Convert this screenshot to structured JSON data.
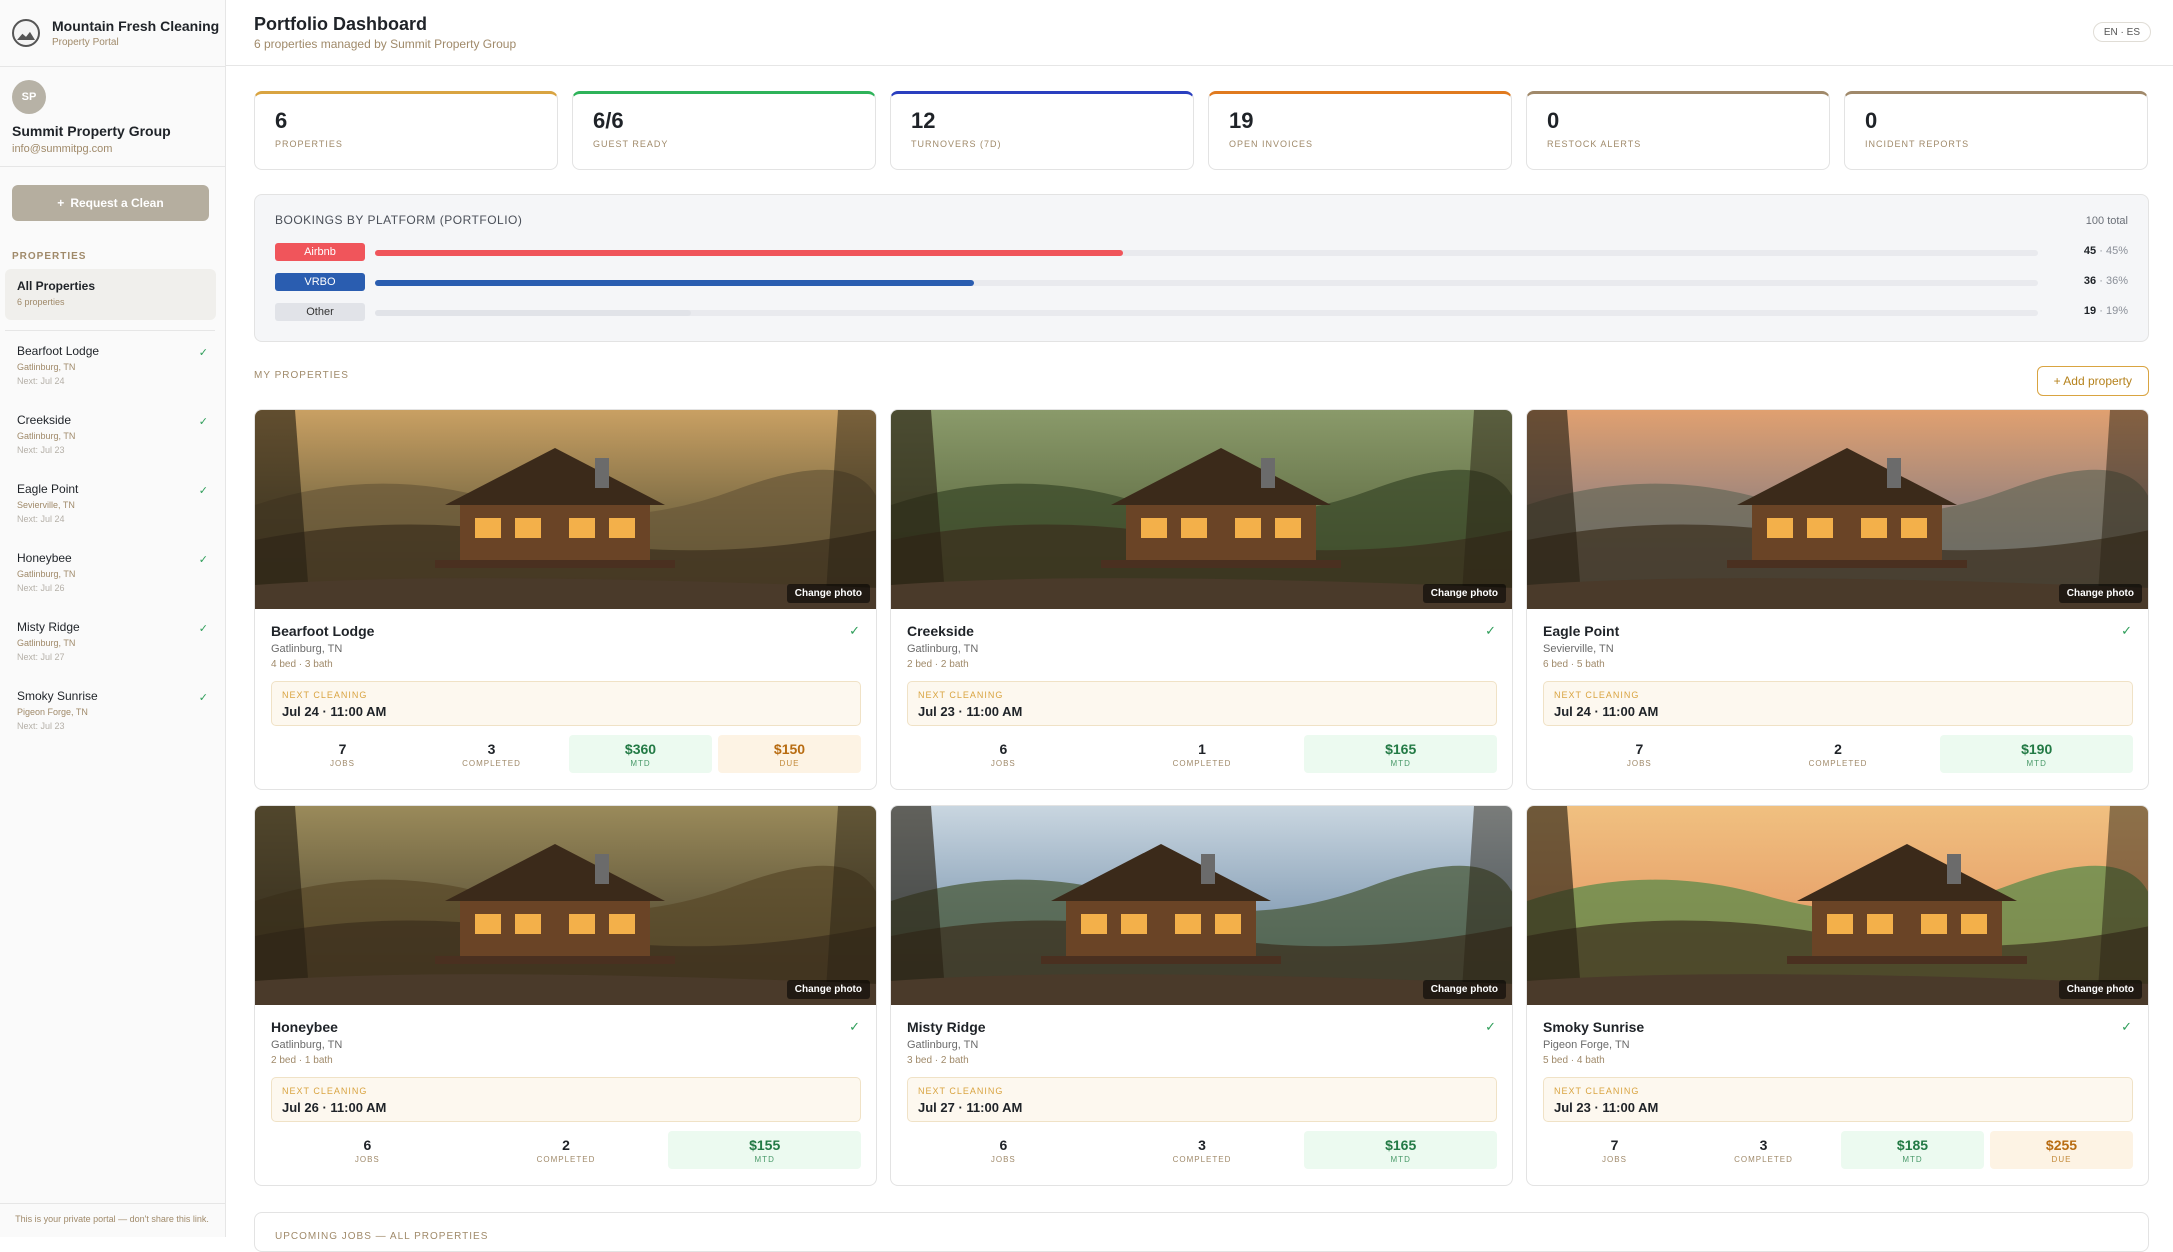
{
  "brand": {
    "name": "Mountain Fresh Cleaning",
    "subtitle": "Property Portal"
  },
  "client": {
    "initials": "SP",
    "name": "Summit Property Group",
    "email": "info@summitpg.com"
  },
  "sidebar": {
    "request_label": "Request a Clean",
    "request_icon": "+",
    "section_label": "PROPERTIES",
    "all_properties": {
      "label": "All Properties",
      "count": "6 properties"
    },
    "properties": [
      {
        "name": "Bearfoot Lodge",
        "location": "Gatlinburg, TN",
        "next": "Next: Jul 24"
      },
      {
        "name": "Creekside",
        "location": "Gatlinburg, TN",
        "next": "Next: Jul 23"
      },
      {
        "name": "Eagle Point",
        "location": "Sevierville, TN",
        "next": "Next: Jul 24"
      },
      {
        "name": "Honeybee",
        "location": "Gatlinburg, TN",
        "next": "Next: Jul 26"
      },
      {
        "name": "Misty Ridge",
        "location": "Gatlinburg, TN",
        "next": "Next: Jul 27"
      },
      {
        "name": "Smoky Sunrise",
        "location": "Pigeon Forge, TN",
        "next": "Next: Jul 23"
      }
    ],
    "footer": "This is your private portal — don't share this link."
  },
  "header": {
    "title": "Portfolio Dashboard",
    "subtitle": "6 properties managed by Summit Property Group",
    "lang": "EN · ES"
  },
  "stats": [
    {
      "value": "6",
      "label": "PROPERTIES",
      "color": "#d9a441"
    },
    {
      "value": "6/6",
      "label": "GUEST READY",
      "color": "#2fb35a"
    },
    {
      "value": "12",
      "label": "TURNOVERS (7D)",
      "color": "#2a3fbf"
    },
    {
      "value": "19",
      "label": "OPEN INVOICES",
      "color": "#e07a1f"
    },
    {
      "value": "0",
      "label": "RESTOCK ALERTS",
      "color": "#a0896a"
    },
    {
      "value": "0",
      "label": "INCIDENT REPORTS",
      "color": "#a0896a"
    }
  ],
  "bookings": {
    "title": "BOOKINGS BY PLATFORM (PORTFOLIO)",
    "total": "100 total",
    "platforms": [
      {
        "name": "Airbnb",
        "count": "45",
        "pct": "45%",
        "share": 0.45,
        "color": "#f0555b",
        "text": "#ffffff"
      },
      {
        "name": "VRBO",
        "count": "36",
        "pct": "36%",
        "share": 0.36,
        "color": "#2a5db0",
        "text": "#ffffff"
      },
      {
        "name": "Other",
        "count": "19",
        "pct": "19%",
        "share": 0.19,
        "color": "#e1e3e8",
        "text": "#333333"
      }
    ]
  },
  "my_properties": {
    "label": "MY PROPERTIES",
    "add_label": "+ Add property",
    "change_photo": "Change photo",
    "next_label": "NEXT CLEANING"
  },
  "cards": [
    {
      "name": "Bearfoot Lodge",
      "location": "Gatlinburg, TN",
      "beds": "4 bed · 3 bath",
      "next": "Jul 24 · 11:00 AM",
      "jobs": "7",
      "completed": "3",
      "mtd": "$360",
      "due": "$150"
    },
    {
      "name": "Creekside",
      "location": "Gatlinburg, TN",
      "beds": "2 bed · 2 bath",
      "next": "Jul 23 · 11:00 AM",
      "jobs": "6",
      "completed": "1",
      "mtd": "$165",
      "due": ""
    },
    {
      "name": "Eagle Point",
      "location": "Sevierville, TN",
      "beds": "6 bed · 5 bath",
      "next": "Jul 24 · 11:00 AM",
      "jobs": "7",
      "completed": "2",
      "mtd": "$190",
      "due": ""
    },
    {
      "name": "Honeybee",
      "location": "Gatlinburg, TN",
      "beds": "2 bed · 1 bath",
      "next": "Jul 26 · 11:00 AM",
      "jobs": "6",
      "completed": "2",
      "mtd": "$155",
      "due": ""
    },
    {
      "name": "Misty Ridge",
      "location": "Gatlinburg, TN",
      "beds": "3 bed · 2 bath",
      "next": "Jul 27 · 11:00 AM",
      "jobs": "6",
      "completed": "3",
      "mtd": "$165",
      "due": ""
    },
    {
      "name": "Smoky Sunrise",
      "location": "Pigeon Forge, TN",
      "beds": "5 bed · 4 bath",
      "next": "Jul 23 · 11:00 AM",
      "jobs": "7",
      "completed": "3",
      "mtd": "$185",
      "due": "$255"
    }
  ],
  "metric_labels": {
    "jobs": "JOBS",
    "completed": "COMPLETED",
    "mtd": "MTD",
    "due": "DUE"
  },
  "upcoming": {
    "title": "UPCOMING JOBS — ALL PROPERTIES"
  }
}
